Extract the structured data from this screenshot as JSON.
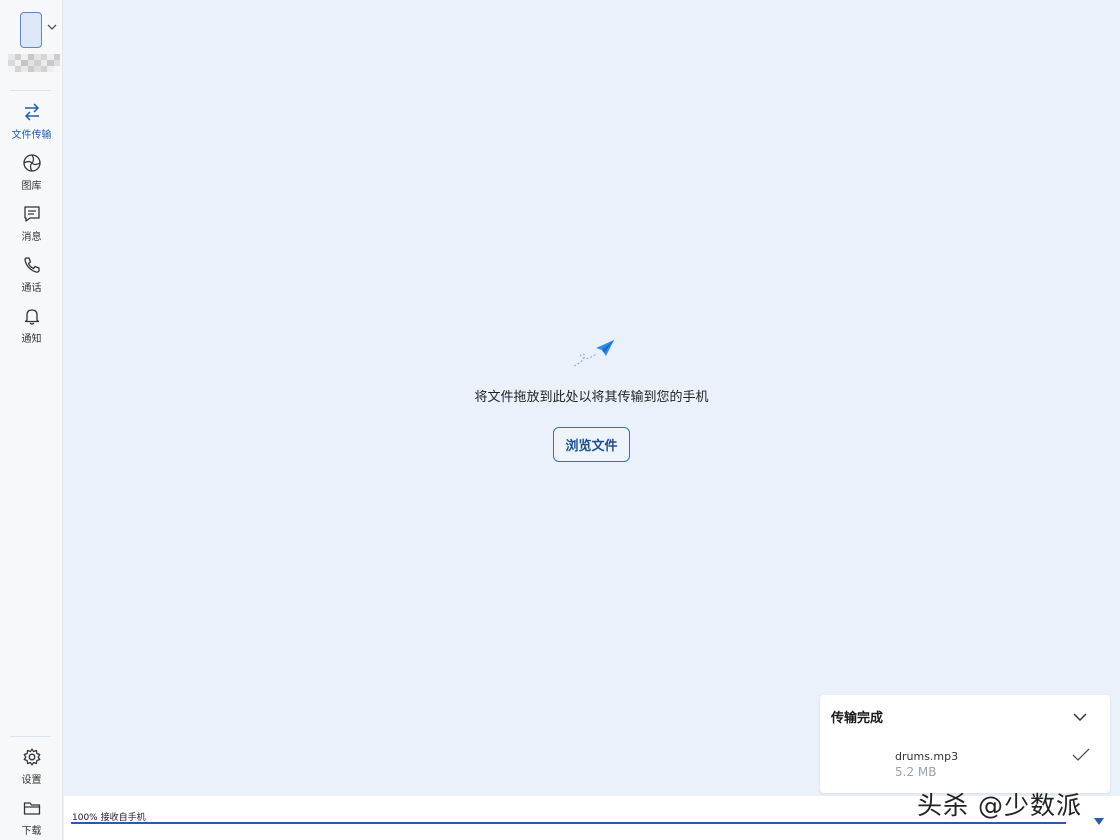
{
  "sidebar": {
    "nav": [
      {
        "label": "文件传输",
        "icon": "transfer-icon"
      },
      {
        "label": "图库",
        "icon": "gallery-icon"
      },
      {
        "label": "消息",
        "icon": "message-icon"
      },
      {
        "label": "通话",
        "icon": "phone-icon"
      },
      {
        "label": "通知",
        "icon": "bell-icon"
      }
    ],
    "bottom": [
      {
        "label": "设置",
        "icon": "gear-icon"
      },
      {
        "label": "下载",
        "icon": "folder-icon"
      }
    ]
  },
  "main": {
    "drop_text": "将文件拖放到此处以将其传输到您的手机",
    "browse_label": "浏览文件"
  },
  "transfer_panel": {
    "title": "传输完成",
    "file_name": "drums.mp3",
    "file_size": "5.2 MB"
  },
  "statusbar": {
    "text": "100%  接收自手机",
    "progress": 1.0
  },
  "watermark": "头杀 @少数派",
  "colors": {
    "accent": "#1f5fa8",
    "background": "#eaf1fb",
    "sidebar": "#f7f8fa"
  }
}
